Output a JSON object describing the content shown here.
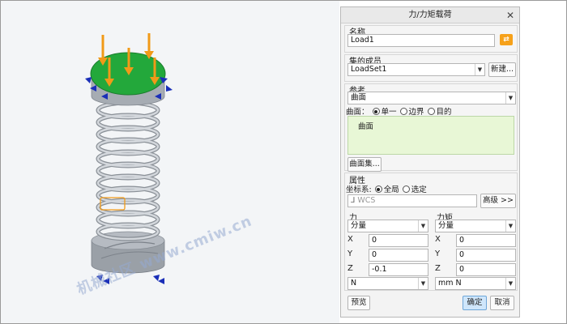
{
  "dialog": {
    "title": "力/力矩载荷",
    "name_label": "名称",
    "name_value": "Load1",
    "members_label": "集的成员",
    "members_value": "LoadSet1",
    "new_button": "新建...",
    "reference_label": "参考",
    "reference_value": "曲面",
    "surface_prefix": "曲面：",
    "surface_options": [
      "单一",
      "边界",
      "目的"
    ],
    "surface_selected": "单一",
    "collector_item": "曲面",
    "surface_set_button": "曲面集...",
    "properties_label": "属性",
    "coord_prefix": "坐标系:",
    "coord_options": [
      "全局",
      "选定"
    ],
    "coord_selected": "全局",
    "wcs_value": "WCS",
    "advanced_button": "高级 >>",
    "force": {
      "label": "力",
      "mode": "分量",
      "x": "0",
      "y": "0",
      "z": "-0.1",
      "unit": "N"
    },
    "moment": {
      "label": "力矩",
      "mode": "分量",
      "x": "0",
      "y": "0",
      "z": "0",
      "unit": "mm N"
    },
    "axis_labels": [
      "X",
      "Y",
      "Z"
    ],
    "preview_button": "预览",
    "ok_button": "确定",
    "cancel_button": "取消"
  },
  "viewport": {
    "watermark": "机械社区 www.cmiw.cn",
    "colors": {
      "top_plate": "#23a83b",
      "arrow": "#f19a18",
      "constraint": "#1a2fb8",
      "spring": "#b9bec5",
      "base": "#a9aeb5"
    }
  }
}
